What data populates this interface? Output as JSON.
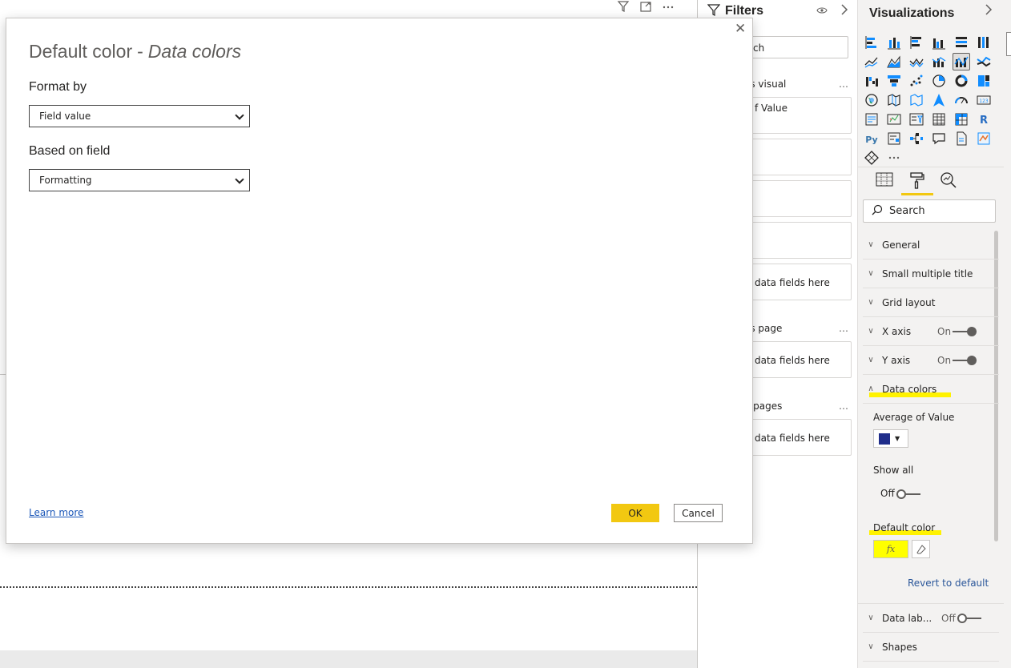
{
  "canvas": {
    "toolbar_icons": [
      "filter-icon",
      "focus-mode-icon",
      "more-options-icon"
    ]
  },
  "filters": {
    "title": "Filters",
    "search_fragment": "ch",
    "this_visual_label": "is visual",
    "this_visual_card": "f Value",
    "drop_hint": "data fields here",
    "this_page_label": "is page",
    "all_pages_label": "l pages",
    "more": "…"
  },
  "viz": {
    "title": "Visualizations",
    "search_placeholder": "Search",
    "sections": {
      "general": "General",
      "small_multiple_title": "Small multiple title",
      "grid_layout": "Grid layout",
      "x_axis": "X axis",
      "y_axis": "Y axis",
      "data_colors": "Data colors",
      "data_labels": "Data lab...",
      "shapes": "Shapes"
    },
    "on": "On",
    "off": "Off",
    "data_colors": {
      "average_of_value": "Average of Value",
      "swatch_color": "#1f2d8a",
      "show_all": "Show all",
      "show_all_state": "Off",
      "default_color": "Default color",
      "fx": "fx",
      "revert": "Revert to default"
    },
    "highlight_color": "#fff200",
    "accent_color": "#f2c811"
  },
  "modal": {
    "title_main": "Default color",
    "title_sep": "-",
    "title_sub": "Data colors",
    "format_by_label": "Format by",
    "format_by_value": "Field value",
    "based_on_label": "Based on field",
    "based_on_value": "Formatting",
    "learn_more": "Learn more",
    "ok": "OK",
    "cancel": "Cancel",
    "close": "✕"
  }
}
